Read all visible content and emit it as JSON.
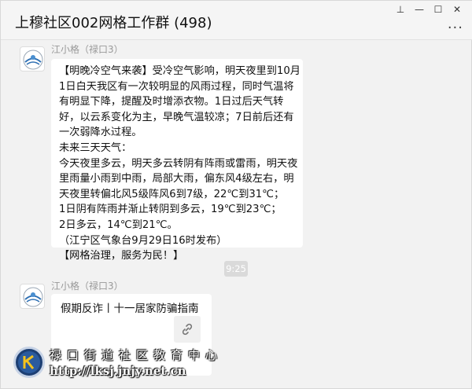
{
  "window": {
    "title": "上穆社区002网格工作群 (498)",
    "controls": {
      "pin": "⊥",
      "minimize": "—",
      "maximize": "☐",
      "close": "✕"
    },
    "more": "···"
  },
  "messages": [
    {
      "sender": "江小格（禄口3）",
      "lines": [
        "【明晚冷空气来袭】受冷空气影响，明天夜里到10月",
        "1日白天我区有一次较明显的风雨过程，同时气温将",
        "有明显下降，提醒及时增添衣物。1日过后天气转",
        "好，以云系变化为主，早晚气温较凉；7日前后还有",
        "一次弱降水过程。",
        "未来三天天气：",
        "今天夜里多云，明天多云转阴有阵雨或雷雨，明天夜",
        "里雨量小雨到中雨，局部大雨，偏东风4级左右，明",
        "天夜里转偏北风5级阵风6到7级，22℃到31℃；",
        "1日阴有阵雨并渐止转阴到多云，19℃到23℃；",
        "2日多云，14℃到21℃。",
        "（江宁区气象台9月29日16时发布）",
        "【网格治理，服务为民！】"
      ]
    },
    {
      "time": "9:25"
    },
    {
      "sender": "江小格（禄口3）",
      "card_title": "假期反诈丨十一居家防骗指南"
    }
  ],
  "watermark": {
    "line1": "禄口街道社区教育中心",
    "line2": "http://lksj.jnjy.net.cn"
  }
}
